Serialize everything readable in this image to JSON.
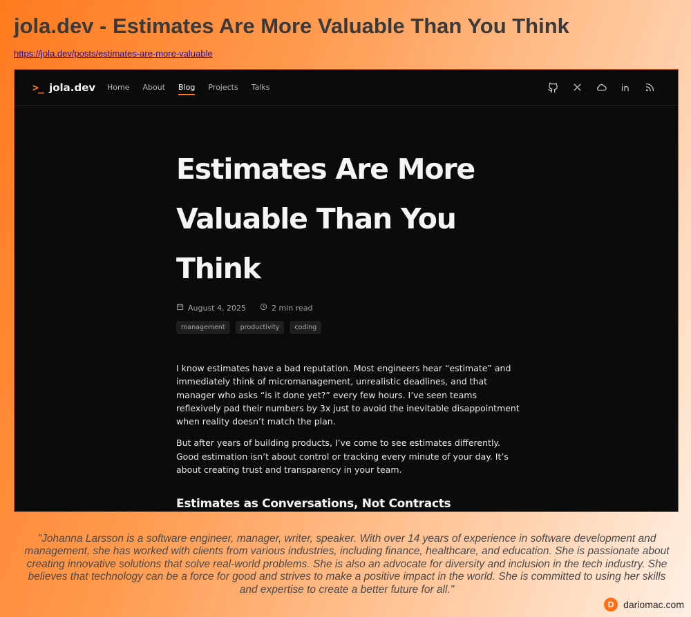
{
  "page": {
    "title": "jola.dev - Estimates Are More Valuable Than You Think",
    "url": "https://jola.dev/posts/estimates-are-more-valuable"
  },
  "site": {
    "brand_prompt": ">_",
    "brand_name": "jola.dev",
    "nav": [
      {
        "label": "Home"
      },
      {
        "label": "About"
      },
      {
        "label": "Blog"
      },
      {
        "label": "Projects"
      },
      {
        "label": "Talks"
      }
    ],
    "active_nav": "Blog",
    "social_icons": [
      "github-icon",
      "x-icon",
      "bluesky-icon",
      "linkedin-icon",
      "rss-icon"
    ],
    "accent_color": "#ff7a1e"
  },
  "article": {
    "title": "Estimates Are More Valuable Than You Think",
    "date": "August 4, 2025",
    "read_time": "2 min read",
    "tags": [
      "management",
      "productivity",
      "coding"
    ],
    "paragraphs": [
      "I know estimates have a bad reputation. Most engineers hear “estimate” and immediately think of micromanagement, unrealistic deadlines, and that manager who asks “is it done yet?” every few hours. I’ve seen teams reflexively pad their numbers by 3x just to avoid the inevitable disappointment when reality doesn’t match the plan.",
      "But after years of building products, I’ve come to see estimates differently. Good estimation isn’t about control or tracking every minute of your day. It’s about creating trust and transparency in your team."
    ],
    "subheading": "Estimates as Conversations, Not Contracts"
  },
  "quote": "\"Johanna Larsson is a software engineer, manager, writer, speaker. With over 14 years of experience in software development and management, she has worked with clients from various industries, including finance, healthcare, and education. She is passionate about creating innovative solutions that solve real-world problems. She is also an advocate for diversity and inclusion in the tech industry. She believes that technology can be a force for good and strives to make a positive impact in the world. She is committed to using her skills and expertise to create a better future for all.\"",
  "credit": {
    "logo_letter": "D",
    "name": "dariomac.com"
  }
}
